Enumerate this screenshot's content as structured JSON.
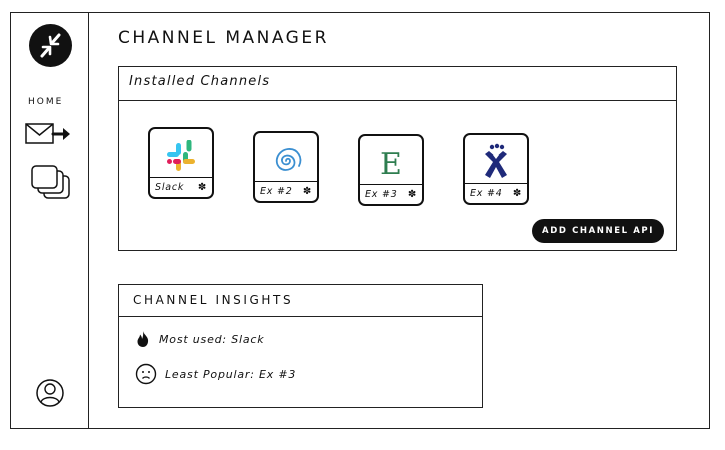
{
  "app": {
    "title": "CHANNEL MANAGER"
  },
  "sidebar": {
    "home_label": "HOME",
    "items": [
      {
        "name": "inbox-send",
        "icon": "envelope-arrow-icon"
      },
      {
        "name": "stacked-cards",
        "icon": "stack-icon"
      }
    ],
    "footer_icon": "user-icon",
    "logo_icon": "compress-arrows-icon"
  },
  "installed": {
    "header": "Installed Channels",
    "channels": [
      {
        "label": "Slack",
        "icon": "slack-icon"
      },
      {
        "label": "Ex #2",
        "icon": "spiral-icon"
      },
      {
        "label": "Ex #3",
        "icon": "letter-e-icon",
        "glyph": "E"
      },
      {
        "label": "Ex #4",
        "icon": "confluence-x-icon"
      }
    ],
    "add_button": "ADD CHANNEL API"
  },
  "insights": {
    "header": "CHANNEL INSIGHTS",
    "most_used": "Most used: Slack",
    "least_popular": "Least Popular: Ex #3"
  },
  "colors": {
    "ink": "#111111",
    "slack_blue": "#36c5f0",
    "slack_green": "#2eb67d",
    "slack_yellow": "#ecb22e",
    "slack_red": "#e01e5a",
    "spiral_blue": "#3b8fd1",
    "e_green": "#2e7d4f",
    "x_navy": "#1f2a7a"
  }
}
